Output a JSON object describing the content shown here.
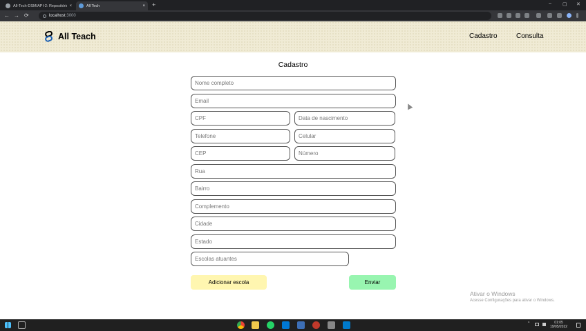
{
  "browser": {
    "tabs": [
      {
        "title": "All-Tech-DSM/API-2: Repositório...",
        "active": false
      },
      {
        "title": "All Tech",
        "active": true
      }
    ],
    "new_tab": "+",
    "close_glyph": "×",
    "url_host": "localhost",
    "url_port": ":3000",
    "nav": {
      "back": "←",
      "forward": "→",
      "reload": "⟳"
    },
    "window_controls": {
      "minimize": "–",
      "maximize": "▢",
      "close": "✕"
    }
  },
  "header": {
    "brand": "All Teach",
    "nav": [
      "Cadastro",
      "Consulta"
    ]
  },
  "form": {
    "title": "Cadastro",
    "placeholders": {
      "nome": "Nome completo",
      "email": "Email",
      "cpf": "CPF",
      "nascimento": "Data de nascimento",
      "telefone": "Telefone",
      "celular": "Celular",
      "cep": "CEP",
      "numero": "Número",
      "rua": "Rua",
      "bairro": "Bairro",
      "complemento": "Complemento",
      "cidade": "Cidade",
      "estado": "Estado",
      "escolas": "Escolas atuantes"
    },
    "buttons": {
      "add_school": "Adicionar escola",
      "submit": "Enviar"
    }
  },
  "watermark": {
    "line1": "Ativar o Windows",
    "line2": "Acesse Configurações para ativar o Windows."
  },
  "taskbar": {
    "tray": "^",
    "time": "01:05",
    "date": "19/05/2022"
  },
  "colors": {
    "header_bg": "#f0ebd5",
    "add_button": "#fff6b0",
    "submit_button": "#98f5b0"
  }
}
